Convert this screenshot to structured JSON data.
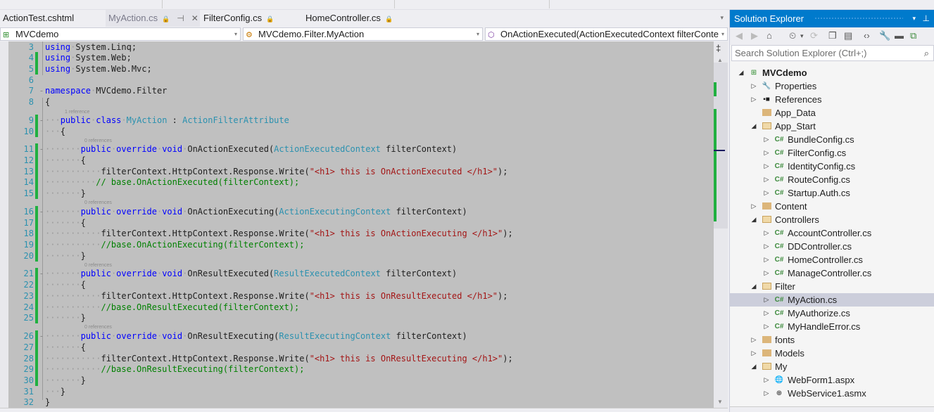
{
  "tabs": [
    {
      "label": "ActionTest.cshtml",
      "active": false
    },
    {
      "label": "MyAction.cs",
      "active": true,
      "lock": "🔒",
      "pin": "⊣",
      "close": "✕"
    },
    {
      "label": "FilterConfig.cs",
      "active": false,
      "lock": "🔒"
    },
    {
      "label": "HomeController.cs",
      "active": false,
      "lock": "🔒"
    }
  ],
  "tabs_overflow": "▾",
  "navbar": {
    "project": "MVCdemo",
    "type": "MVCdemo.Filter.MyAction",
    "member": "OnActionExecuted(ActionExecutedContext filterConte",
    "dropdown": "▾"
  },
  "editor": {
    "hints": {
      "class": "1 reference",
      "method": "0 references"
    },
    "lines": [
      {
        "n": "3"
      },
      {
        "n": "4"
      },
      {
        "n": "5"
      },
      {
        "n": "6"
      },
      {
        "n": "7"
      },
      {
        "n": "8"
      },
      {
        "n": "9"
      },
      {
        "n": "10"
      },
      {
        "n": "11"
      },
      {
        "n": "12"
      },
      {
        "n": "13"
      },
      {
        "n": "14"
      },
      {
        "n": "15"
      },
      {
        "n": "16"
      },
      {
        "n": "17"
      },
      {
        "n": "18"
      },
      {
        "n": "19"
      },
      {
        "n": "20"
      },
      {
        "n": "21"
      },
      {
        "n": "22"
      },
      {
        "n": "23"
      },
      {
        "n": "24"
      },
      {
        "n": "25"
      },
      {
        "n": "26"
      },
      {
        "n": "27"
      },
      {
        "n": "28"
      },
      {
        "n": "29"
      },
      {
        "n": "30"
      },
      {
        "n": "31"
      },
      {
        "n": "32"
      }
    ],
    "tokens": {
      "using": "using",
      "ns_linq": "System.Linq;",
      "ns_web": "System.Web;",
      "ns_mvc": "System.Web.Mvc;",
      "namespace": "namespace",
      "ns_name": "MVCdemo.Filter",
      "lbrace": "{",
      "rbrace": "}",
      "public": "public",
      "class": "class",
      "override": "override",
      "void": "void",
      "class_name": "MyAction",
      "colon": " : ",
      "base_class": "ActionFilterAttribute",
      "write_prefix": "filterContext.HttpContext.Response.Write(",
      "write_suffix": ");",
      "param_name": " filterContext)",
      "methods": [
        {
          "name": "OnActionExecuted(",
          "ctx": "ActionExecutedContext",
          "str": "\"<h1> this is OnActionExecuted </h1>\"",
          "comment": "// base.OnActionExecuted(filterContext);"
        },
        {
          "name": "OnActionExecuting(",
          "ctx": "ActionExecutingContext",
          "str": "\"<h1> this is OnActionExecuting </h1>\"",
          "comment": "//base.OnActionExecuting(filterContext);"
        },
        {
          "name": "OnResultExecuted(",
          "ctx": "ResultExecutedContext",
          "str": "\"<h1> this is OnResultExecuted </h1>\"",
          "comment": "//base.OnResultExecuted(filterContext);"
        },
        {
          "name": "OnResultExecuting(",
          "ctx": "ResultExecutingContext",
          "str": "\"<h1> this is OnResultExecuting </h1>\"",
          "comment": "//base.OnResultExecuting(filterContext);"
        }
      ]
    }
  },
  "solution_explorer": {
    "title": "Solution Explorer",
    "title_dropdown": "▾",
    "title_pin": "⊥",
    "search_placeholder": "Search Solution Explorer (Ctrl+;)",
    "search_icon": "⌕",
    "toolbar": [
      "◀",
      "▶",
      "⌂",
      "⏲",
      "▾",
      "⟳",
      "❐",
      "▤",
      "‹›",
      "🔧",
      "▬",
      "⧉"
    ],
    "tree": [
      {
        "label": "MVCdemo",
        "level": 0,
        "expander": "◢",
        "icon": "project-icon",
        "glyph": "⊞",
        "bold": true
      },
      {
        "label": "Properties",
        "level": 1,
        "expander": "▷",
        "icon": "wrench-icon",
        "glyph": "🔧"
      },
      {
        "label": "References",
        "level": 1,
        "expander": "▷",
        "icon": "references-icon",
        "glyph": "▪■"
      },
      {
        "label": "App_Data",
        "level": 1,
        "expander": "",
        "icon": "folder-icon"
      },
      {
        "label": "App_Start",
        "level": 1,
        "expander": "◢",
        "icon": "folder-open-icon"
      },
      {
        "label": "BundleConfig.cs",
        "level": 2,
        "expander": "▷",
        "icon": "csharp-file-icon",
        "glyph": "C#"
      },
      {
        "label": "FilterConfig.cs",
        "level": 2,
        "expander": "▷",
        "icon": "csharp-file-icon",
        "glyph": "C#"
      },
      {
        "label": "IdentityConfig.cs",
        "level": 2,
        "expander": "▷",
        "icon": "csharp-file-icon",
        "glyph": "C#"
      },
      {
        "label": "RouteConfig.cs",
        "level": 2,
        "expander": "▷",
        "icon": "csharp-file-icon",
        "glyph": "C#"
      },
      {
        "label": "Startup.Auth.cs",
        "level": 2,
        "expander": "▷",
        "icon": "csharp-file-icon",
        "glyph": "C#"
      },
      {
        "label": "Content",
        "level": 1,
        "expander": "▷",
        "icon": "folder-icon"
      },
      {
        "label": "Controllers",
        "level": 1,
        "expander": "◢",
        "icon": "folder-open-icon"
      },
      {
        "label": "AccountController.cs",
        "level": 2,
        "expander": "▷",
        "icon": "csharp-file-icon",
        "glyph": "C#"
      },
      {
        "label": "DDController.cs",
        "level": 2,
        "expander": "▷",
        "icon": "csharp-file-icon",
        "glyph": "C#"
      },
      {
        "label": "HomeController.cs",
        "level": 2,
        "expander": "▷",
        "icon": "csharp-file-icon",
        "glyph": "C#"
      },
      {
        "label": "ManageController.cs",
        "level": 2,
        "expander": "▷",
        "icon": "csharp-file-icon",
        "glyph": "C#"
      },
      {
        "label": "Filter",
        "level": 1,
        "expander": "◢",
        "icon": "folder-open-icon"
      },
      {
        "label": "MyAction.cs",
        "level": 2,
        "expander": "▷",
        "icon": "csharp-file-icon",
        "glyph": "C#",
        "selected": true
      },
      {
        "label": "MyAuthorize.cs",
        "level": 2,
        "expander": "▷",
        "icon": "csharp-file-icon",
        "glyph": "C#"
      },
      {
        "label": "MyHandleError.cs",
        "level": 2,
        "expander": "▷",
        "icon": "csharp-file-icon",
        "glyph": "C#"
      },
      {
        "label": "fonts",
        "level": 1,
        "expander": "▷",
        "icon": "folder-icon"
      },
      {
        "label": "Models",
        "level": 1,
        "expander": "▷",
        "icon": "folder-icon"
      },
      {
        "label": "My",
        "level": 1,
        "expander": "◢",
        "icon": "folder-open-icon"
      },
      {
        "label": "WebForm1.aspx",
        "level": 2,
        "expander": "▷",
        "icon": "webform-icon",
        "glyph": "🌐"
      },
      {
        "label": "WebService1.asmx",
        "level": 2,
        "expander": "▷",
        "icon": "webservice-icon",
        "glyph": "⊕"
      }
    ]
  }
}
